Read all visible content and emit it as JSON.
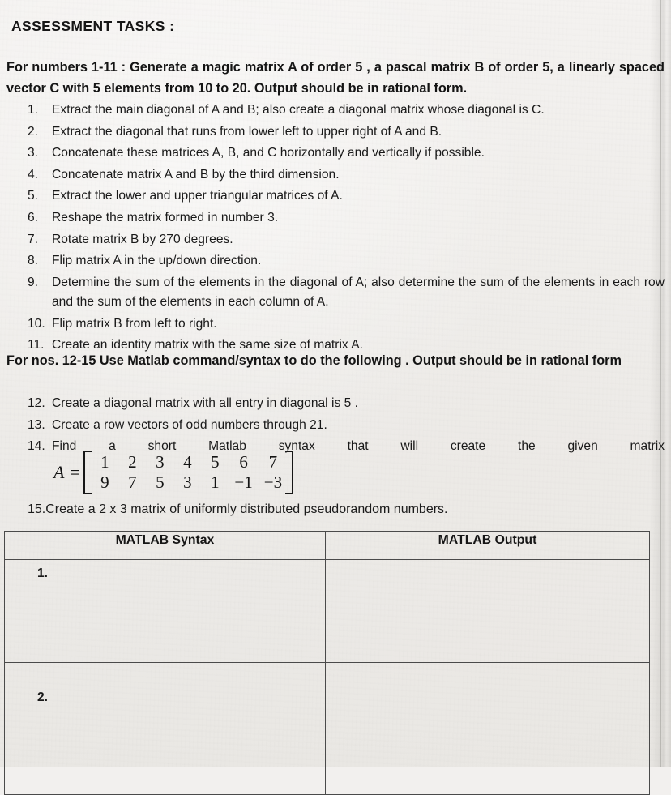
{
  "document": {
    "title": "ASSESSMENT TASKS :",
    "intro_1": "For numbers 1-11 : Generate a magic matrix A of order 5 , a pascal matrix B of order 5, a linearly spaced vector C with 5 elements from  10 to  20. Output should be in rational form.",
    "intro_2": "For nos. 12-15 Use  Matlab command/syntax  to do the following . Output should be in rational form"
  },
  "tasks_group_1": [
    {
      "number": "1.",
      "text": "Extract the main diagonal of A and B; also create a diagonal matrix whose diagonal is C."
    },
    {
      "number": "2.",
      "text": "Extract the diagonal that runs from lower left to upper right of A and B."
    },
    {
      "number": "3.",
      "text": "Concatenate these matrices A, B, and C horizontally and vertically if possible."
    },
    {
      "number": "4.",
      "text": "Concatenate matrix A and B by the third dimension."
    },
    {
      "number": "5.",
      "text": "Extract the lower and upper triangular matrices of A."
    },
    {
      "number": "6.",
      "text": "Reshape the matrix formed in number 3."
    },
    {
      "number": "7.",
      "text": "Rotate matrix B by 270 degrees."
    },
    {
      "number": "8.",
      "text": "Flip matrix A in the up/down direction."
    },
    {
      "number": "9.",
      "text": "Determine the sum of the elements in the diagonal of A; also determine the sum of the elements in each row and the sum of the elements in each column of A."
    },
    {
      "number": "10.",
      "text": "Flip matrix B from left to right."
    },
    {
      "number": "11.",
      "text": "Create an identity matrix with the same size of matrix A."
    }
  ],
  "tasks_group_2": [
    {
      "number": "12.",
      "text": "Create a diagonal matrix with all entry in diagonal is 5 ."
    },
    {
      "number": "13.",
      "text": "Create a row vectors of odd numbers through 21."
    },
    {
      "number": "14.",
      "text": "Find a short Matlab syntax that will create the given matrix"
    },
    {
      "number": "15.",
      "text": "Create a 2 x 3 matrix of uniformly distributed pseudorandom numbers."
    }
  ],
  "matrix": {
    "label": "A =",
    "rows": [
      [
        "1",
        "2",
        "3",
        "4",
        "5",
        "6",
        "7"
      ],
      [
        "9",
        "7",
        "5",
        "3",
        "1",
        "−1",
        "−3"
      ]
    ]
  },
  "answer_table": {
    "headers": [
      "MATLAB Syntax",
      "MATLAB Output"
    ],
    "rows": [
      {
        "label": "1.",
        "syntax": "",
        "output": ""
      },
      {
        "label": "2.",
        "syntax": "",
        "output": ""
      }
    ]
  },
  "colors": {
    "paper": "#f0eeea",
    "ink": "#191919",
    "rule": "#4a4a4a"
  }
}
